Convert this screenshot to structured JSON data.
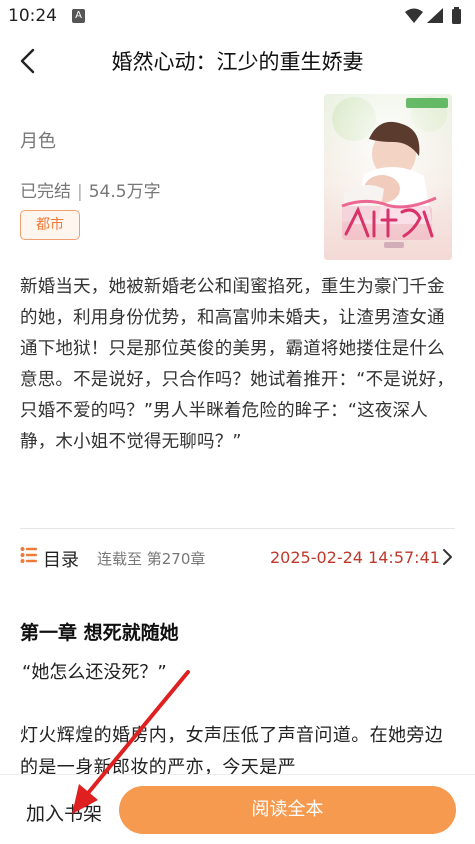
{
  "status_bar": {
    "time": "10:24",
    "notification_badge": "A",
    "icons": [
      "wifi-icon",
      "signal-icon",
      "battery-icon"
    ]
  },
  "header": {
    "title": "婚然心动：江少的重生娇妻"
  },
  "book": {
    "author": "月色",
    "status": "已完结",
    "word_count": "54.5万字",
    "genre": "都市",
    "synopsis": "新婚当天，她被新婚老公和闺蜜掐死，重生为豪门千金的她，利用身份优势，和高富帅未婚夫，让渣男渣女通通下地狱！只是那位英俊的美男，霸道将她搂住是什么意思。不是说好，只合作吗？她试着推开：“不是说好，只婚不爱的吗？”男人半眯着危险的眸子：“这夜深人静，木小姐不觉得无聊吗？”"
  },
  "toc": {
    "label": "目录",
    "latest": "连载至 第270章",
    "updated": "2025-02-24 14:57:41"
  },
  "chapter": {
    "title": "第一章 想死就随她",
    "para1": "“她怎么还没死？”",
    "para2": "灯火辉煌的婚房内，女声压低了声音问道。在她旁边的是一身新郎妆的严亦，今天是严"
  },
  "bottom": {
    "add_shelf": "加入书架",
    "read_all": "阅读全本"
  },
  "colors": {
    "accent": "#f59a4f",
    "tag_text": "#f07a3a",
    "timestamp": "#c0392b",
    "annotation_arrow": "#e02020"
  }
}
